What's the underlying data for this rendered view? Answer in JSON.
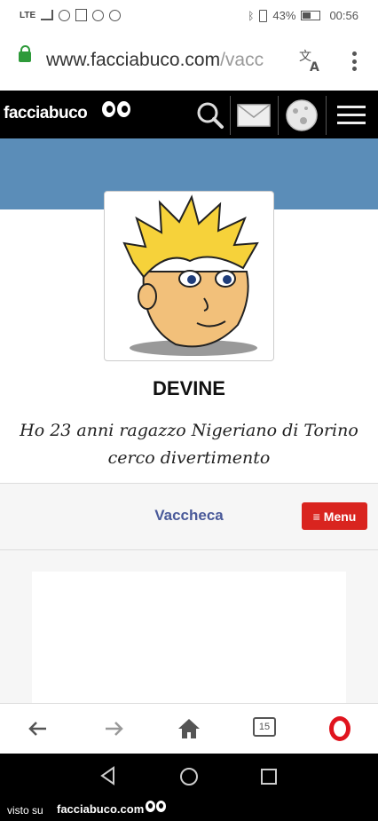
{
  "status_bar": {
    "network": "LTE",
    "battery_percent_text": "43%",
    "battery_level": 0.43,
    "time": "00:56"
  },
  "browser": {
    "url_main": "www.facciabuco.com",
    "url_rest": "/vacc",
    "tab_count": "15"
  },
  "site": {
    "logo": "facciabuco"
  },
  "profile": {
    "name": "DEVINE",
    "bio": "Ho 23 anni ragazzo Nigeriano di Torino cerco divertimento"
  },
  "nav": {
    "link": "Vaccheca",
    "menu_label": "Menu",
    "menu_icon": "≡"
  },
  "footer": {
    "prefix": "visto su",
    "logo": "facciabuco.com"
  },
  "colors": {
    "band": "#5b8db8",
    "menu_button": "#d9241f",
    "link": "#4a5a9a",
    "lock": "#2e9a3a",
    "opera": "#e0141e"
  }
}
